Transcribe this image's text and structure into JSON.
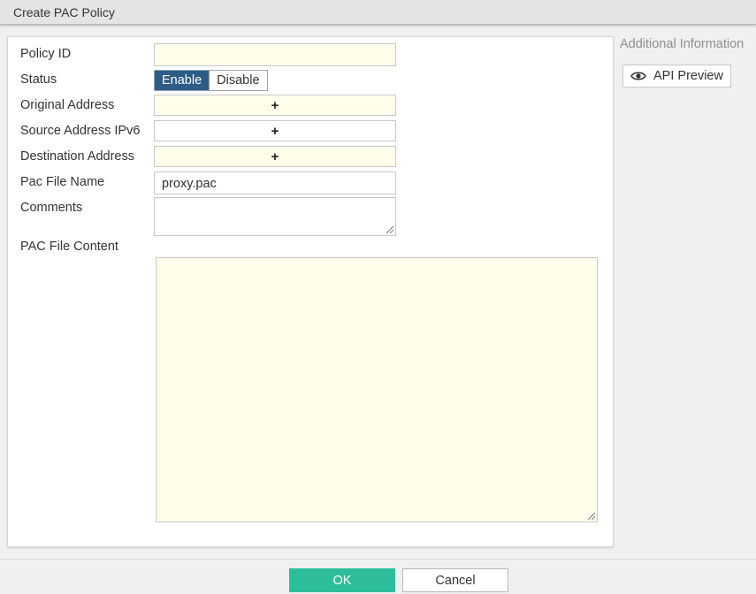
{
  "window": {
    "title": "Create PAC Policy"
  },
  "form": {
    "policy_id": {
      "label": "Policy ID",
      "value": ""
    },
    "status": {
      "label": "Status",
      "options": [
        "Enable",
        "Disable"
      ],
      "selected": "Enable"
    },
    "original_address": {
      "label": "Original Address",
      "add_symbol": "+"
    },
    "source_address_ipv6": {
      "label": "Source Address IPv6",
      "add_symbol": "+"
    },
    "destination_address": {
      "label": "Destination Address",
      "add_symbol": "+"
    },
    "pac_file_name": {
      "label": "Pac File Name",
      "value": "proxy.pac"
    },
    "comments": {
      "label": "Comments",
      "value": ""
    },
    "pac_file_content": {
      "label": "PAC File Content",
      "value": ""
    }
  },
  "sidebar": {
    "title": "Additional Information",
    "api_preview": {
      "label": "API Preview",
      "icon": "eye-icon"
    }
  },
  "footer": {
    "ok_label": "OK",
    "cancel_label": "Cancel"
  },
  "colors": {
    "required_field_bg": "#fefeeb",
    "toggle_active_bg": "#2d5c88",
    "ok_button_bg": "#2ebd9b"
  }
}
